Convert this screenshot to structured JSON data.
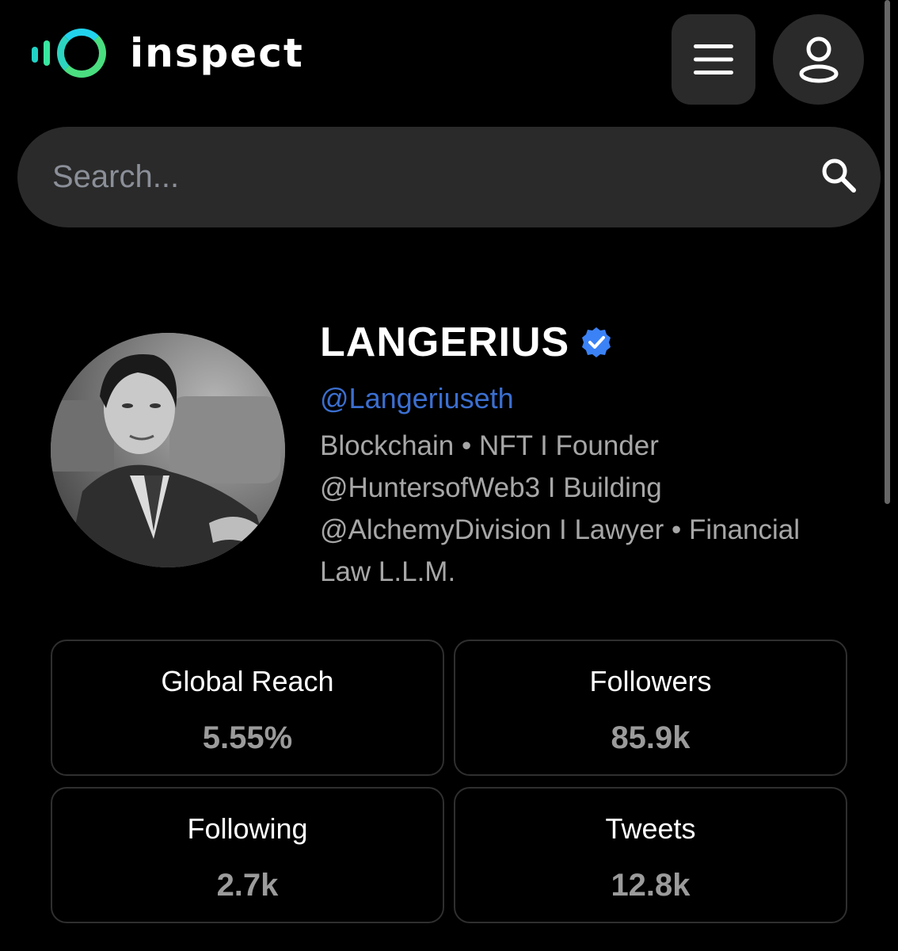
{
  "brand": {
    "name": "inspect"
  },
  "header": {
    "menu_icon": "hamburger-menu-icon",
    "account_icon": "user-icon"
  },
  "search": {
    "placeholder": "Search...",
    "icon": "search-icon"
  },
  "profile": {
    "name": "LANGERIUS",
    "verified_icon": "verified-badge-icon",
    "handle": "@Langeriuseth",
    "bio_lines": [
      "Blockchain • NFT I Founder",
      "@HuntersofWeb3 I Building",
      "@AlchemyDivision I Lawyer • Financial",
      "Law L.L.M."
    ]
  },
  "stats": [
    {
      "label": "Global Reach",
      "value": "5.55%"
    },
    {
      "label": "Followers",
      "value": "85.9k"
    },
    {
      "label": "Following",
      "value": "2.7k"
    },
    {
      "label": "Tweets",
      "value": "12.8k"
    }
  ],
  "colors": {
    "background": "#000000",
    "panel": "#2a2a2a",
    "accent_green": "#4ade80",
    "accent_cyan": "#22d3ee",
    "handle_blue": "#3b6fd0",
    "verified_blue": "#3b82f6"
  }
}
